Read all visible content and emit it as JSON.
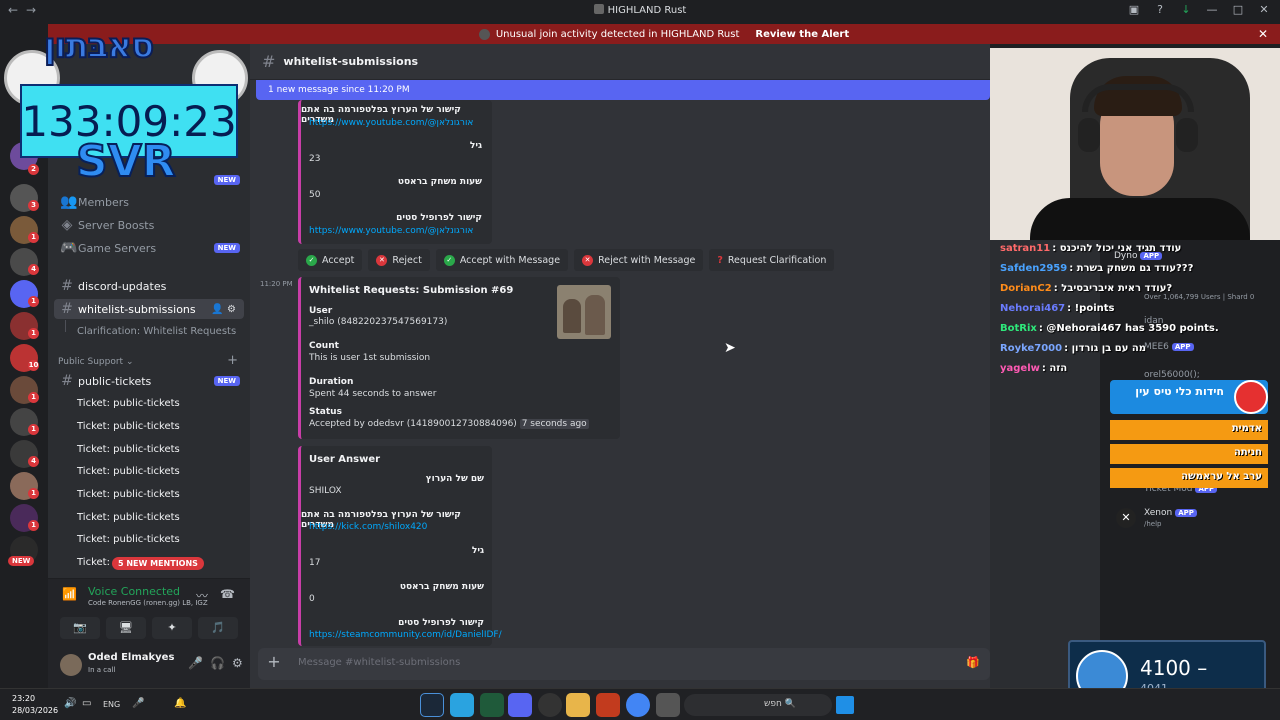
{
  "window": {
    "title": "HIGHLAND Rust"
  },
  "alert": {
    "text": "Unusual join activity detected in HIGHLAND Rust",
    "action": "Review the Alert"
  },
  "overlay": {
    "logo": "סאבּתון",
    "timer": "133:09:23",
    "brand": "SVR"
  },
  "sidebar": {
    "items": [
      {
        "label": "Members"
      },
      {
        "label": "Server Boosts"
      },
      {
        "label": "Game Servers",
        "badge": "NEW"
      }
    ],
    "new_label": "NEW",
    "channels": {
      "discord_updates": "discord-updates",
      "whitelist": "whitelist-submissions",
      "thread": "Clarification: Whitelist Requests",
      "category": "Public Support",
      "public_tickets": "public-tickets",
      "public_tickets_badge": "NEW"
    },
    "tickets": [
      "Ticket: public-tickets",
      "Ticket: public-tickets",
      "Ticket: public-tickets",
      "Ticket: public-tickets",
      "Ticket: public-tickets",
      "Ticket: public-tickets",
      "Ticket: public-tickets",
      "Ticket: p"
    ],
    "mentions": "5 NEW MENTIONS",
    "rail_new": "NEW"
  },
  "voice": {
    "status": "Voice Connected",
    "server": "Code RonenGG (ronen.gg) LB, IGZ"
  },
  "user": {
    "name": "Oded Elmakyes",
    "status": "In a call"
  },
  "chat": {
    "channel": "whitelist-submissions",
    "new_bar": "1 new message since 11:20 PM",
    "prev_embed": {
      "f1_label": "קישור של הערוץ בפלטפורמה בה אתם משדרים",
      "f1_value": "https://www.youtube.com/@אורגונלאן",
      "f2_label": "גיל",
      "f2_value": "23",
      "f3_label": "שעות משחק בראסט",
      "f3_value": "50",
      "f4_label": "קישור לפרופיל סטים",
      "f4_value": "https://www.youtube.com/@אורגונלאן"
    },
    "buttons": [
      "Accept",
      "Reject",
      "Accept with Message",
      "Reject with Message",
      "Request Clarification"
    ],
    "timestamp": "11:20 PM",
    "submission": {
      "title": "Whitelist Requests: Submission #69",
      "user_label": "User",
      "user_value": "_shilo (848220237547569173)",
      "count_label": "Count",
      "count_value": "This is user 1st submission",
      "duration_label": "Duration",
      "duration_value": "Spent 44 seconds to answer",
      "status_label": "Status",
      "status_value": "Accepted by odedsvr (1418900127308840​96)",
      "status_time": "7 seconds ago"
    },
    "answer": {
      "title": "User Answer",
      "f1_label": "שם של הערוץ",
      "f1_value": "SHILOX",
      "f2_label": "קישור של הערוץ בפלטפורמה בה אתם משדרים",
      "f2_value": "https://kick.com/shilox420",
      "f3_label": "גיל",
      "f3_value": "17",
      "f4_label": "שעות משחק בראסט",
      "f4_value": "0",
      "f5_label": "קישור לפרופיל סטים",
      "f5_value": "https://steamcommunity.com/id/DanielIDF/"
    },
    "composer_placeholder": "Message #whitelist-submissions"
  },
  "twitch_chat": [
    {
      "user": "satran11",
      "color": "#ff6a6a",
      "msg": ": עודד תגיד אני יכול להיכנס"
    },
    {
      "user": "Safden2959",
      "color": "#4aa3ff",
      "msg": ": עודד גם משחק בשרת???"
    },
    {
      "user": "DorianC2",
      "color": "#ff8c1a",
      "msg": ": עודד ראית איבריבסיבל?"
    },
    {
      "user": "Nehorai467",
      "color": "#6a7cff",
      "msg": ": !points"
    },
    {
      "user": "BotRix",
      "color": "#2ee87b",
      "msg": ": @Nehorai467 has 3590 points."
    },
    {
      "user": "Royke7000",
      "color": "#7aa6ff",
      "msg": ": מה עם בן גורדון"
    },
    {
      "user": "yagelw",
      "color": "#ff5ab4",
      "msg": ": הזה"
    }
  ],
  "members": [
    {
      "name": "Dyno",
      "tag": "APP"
    },
    {
      "name": "Over 1,064,799 Users | Shard 0"
    },
    {
      "name": "idan"
    },
    {
      "name": "MEE6",
      "tag": "APP"
    },
    {
      "name": "orel56000();"
    },
    {
      "name": "Ticket Mod",
      "tag": "APP"
    },
    {
      "name": "Xenon",
      "tag": "APP"
    },
    {
      "name": "/help"
    }
  ],
  "poll": {
    "title": "חידות כלי טיס עין",
    "options": [
      "אדמית",
      "חניתה",
      "ערב אל עראמשה"
    ]
  },
  "goal": {
    "current": "4100",
    "label": "מטרה",
    "sub": "4041"
  },
  "taskbar": {
    "time": "23:20",
    "date": "28/03/2026",
    "lang": "ENG",
    "search": "חפש"
  },
  "colors": {
    "accent": "#5865f2",
    "embed_border": "#c93ea8",
    "alert_bg": "#8a1c1c",
    "online": "#23a55a"
  }
}
